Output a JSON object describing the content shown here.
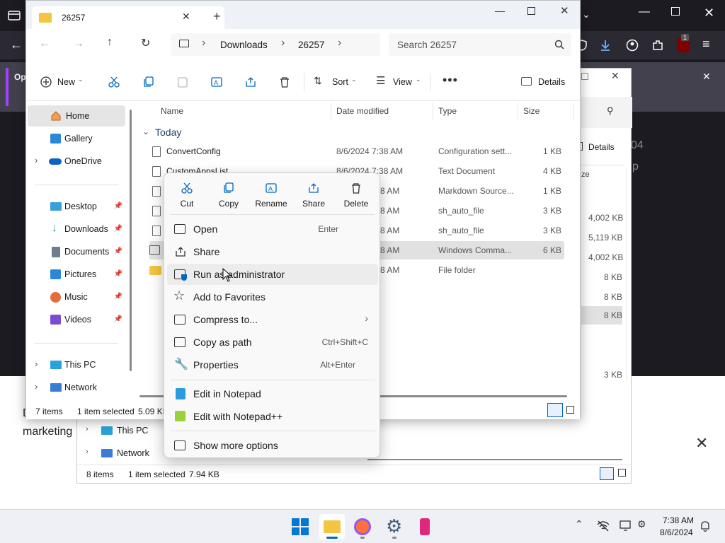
{
  "browser": {
    "notify_prefix": "Op",
    "notify_badge": "1"
  },
  "webpage": {
    "line1": "D",
    "line2": "marketing"
  },
  "back_explorer": {
    "partial_number_1": "04",
    "partial_letter_2": "p",
    "details_label": "Details",
    "size_header_partial": "ze",
    "sizes": [
      "4,002 KB",
      "5,119 KB",
      "4,002 KB",
      "8 KB",
      "8 KB",
      "8 KB",
      "3 KB"
    ],
    "nav_this_pc": "This PC",
    "nav_network": "Network",
    "status_items": "8 items",
    "status_selected": "1 item selected",
    "status_size": "7.94 KB"
  },
  "explorer": {
    "tab_title": "26257",
    "breadcrumb": [
      "Downloads",
      "26257"
    ],
    "search_placeholder": "Search 26257",
    "toolbar": {
      "new_label": "New",
      "sort_label": "Sort",
      "view_label": "View",
      "details_label": "Details"
    },
    "nav": {
      "home": "Home",
      "gallery": "Gallery",
      "onedrive": "OneDrive",
      "desktop": "Desktop",
      "downloads": "Downloads",
      "documents": "Documents",
      "pictures": "Pictures",
      "music": "Music",
      "videos": "Videos",
      "this_pc": "This PC",
      "network": "Network"
    },
    "columns": {
      "name": "Name",
      "date": "Date modified",
      "type": "Type",
      "size": "Size"
    },
    "group_label": "Today",
    "rows": [
      {
        "name": "ConvertConfig",
        "date": "8/6/2024 7:38 AM",
        "type": "Configuration sett...",
        "size": "1 KB"
      },
      {
        "name": "CustomAppsList",
        "date": "8/6/2024 7:38 AM",
        "type": "Text Document",
        "size": "4 KB"
      },
      {
        "name": "",
        "date": "8 AM",
        "type": "Markdown Source...",
        "size": "1 KB"
      },
      {
        "name": "",
        "date": "8 AM",
        "type": "sh_auto_file",
        "size": "3 KB"
      },
      {
        "name": "",
        "date": "8 AM",
        "type": "sh_auto_file",
        "size": "3 KB"
      },
      {
        "name": "",
        "date": "8 AM",
        "type": "Windows Comma...",
        "size": "6 KB"
      },
      {
        "name": "",
        "date": "8 AM",
        "type": "File folder",
        "size": ""
      }
    ],
    "status": {
      "items": "7 items",
      "selected": "1 item selected",
      "size": "5.09 KB"
    }
  },
  "context_menu": {
    "quick_actions": [
      "Cut",
      "Copy",
      "Rename",
      "Share",
      "Delete"
    ],
    "items": [
      {
        "label": "Open",
        "shortcut": "Enter"
      },
      {
        "label": "Share",
        "shortcut": ""
      },
      {
        "label": "Run as administrator",
        "shortcut": ""
      },
      {
        "label": "Add to Favorites",
        "shortcut": ""
      },
      {
        "label": "Compress to...",
        "shortcut": ""
      },
      {
        "label": "Copy as path",
        "shortcut": "Ctrl+Shift+C"
      },
      {
        "label": "Properties",
        "shortcut": "Alt+Enter"
      },
      {
        "label": "Edit in Notepad",
        "shortcut": ""
      },
      {
        "label": "Edit with Notepad++",
        "shortcut": ""
      },
      {
        "label": "Show more options",
        "shortcut": ""
      }
    ]
  },
  "taskbar": {
    "time": "7:38 AM",
    "date": "8/6/2024"
  },
  "colors": {
    "accent": "#0067c0",
    "folder": "#f4c542",
    "selection": "#e1e1e1"
  }
}
